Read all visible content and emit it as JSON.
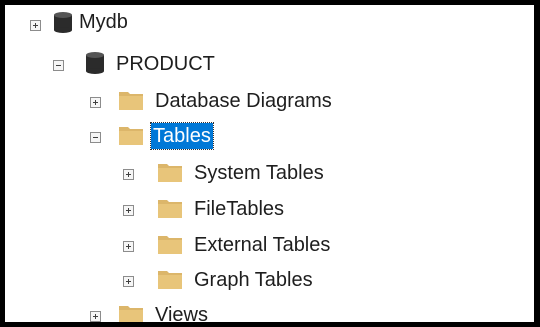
{
  "tree": {
    "mydb": {
      "label": "Mydb",
      "icon": "database-icon",
      "state": "collapsed"
    },
    "product": {
      "label": "PRODUCT",
      "icon": "database-icon",
      "state": "expanded"
    },
    "database_diagrams": {
      "label": "Database Diagrams",
      "icon": "folder-icon",
      "state": "collapsed"
    },
    "tables": {
      "label": "Tables",
      "icon": "folder-icon",
      "state": "expanded",
      "selected": true
    },
    "system_tables": {
      "label": "System Tables",
      "icon": "folder-icon",
      "state": "collapsed"
    },
    "file_tables": {
      "label": "FileTables",
      "icon": "folder-icon",
      "state": "collapsed"
    },
    "external_tables": {
      "label": "External Tables",
      "icon": "folder-icon",
      "state": "collapsed"
    },
    "graph_tables": {
      "label": "Graph Tables",
      "icon": "folder-icon",
      "state": "collapsed"
    },
    "views": {
      "label": "Views",
      "icon": "folder-icon",
      "state": "collapsed"
    }
  },
  "colors": {
    "selection": "#0078d7",
    "folder": "#dcb66a",
    "database": "#2b2b2b"
  }
}
